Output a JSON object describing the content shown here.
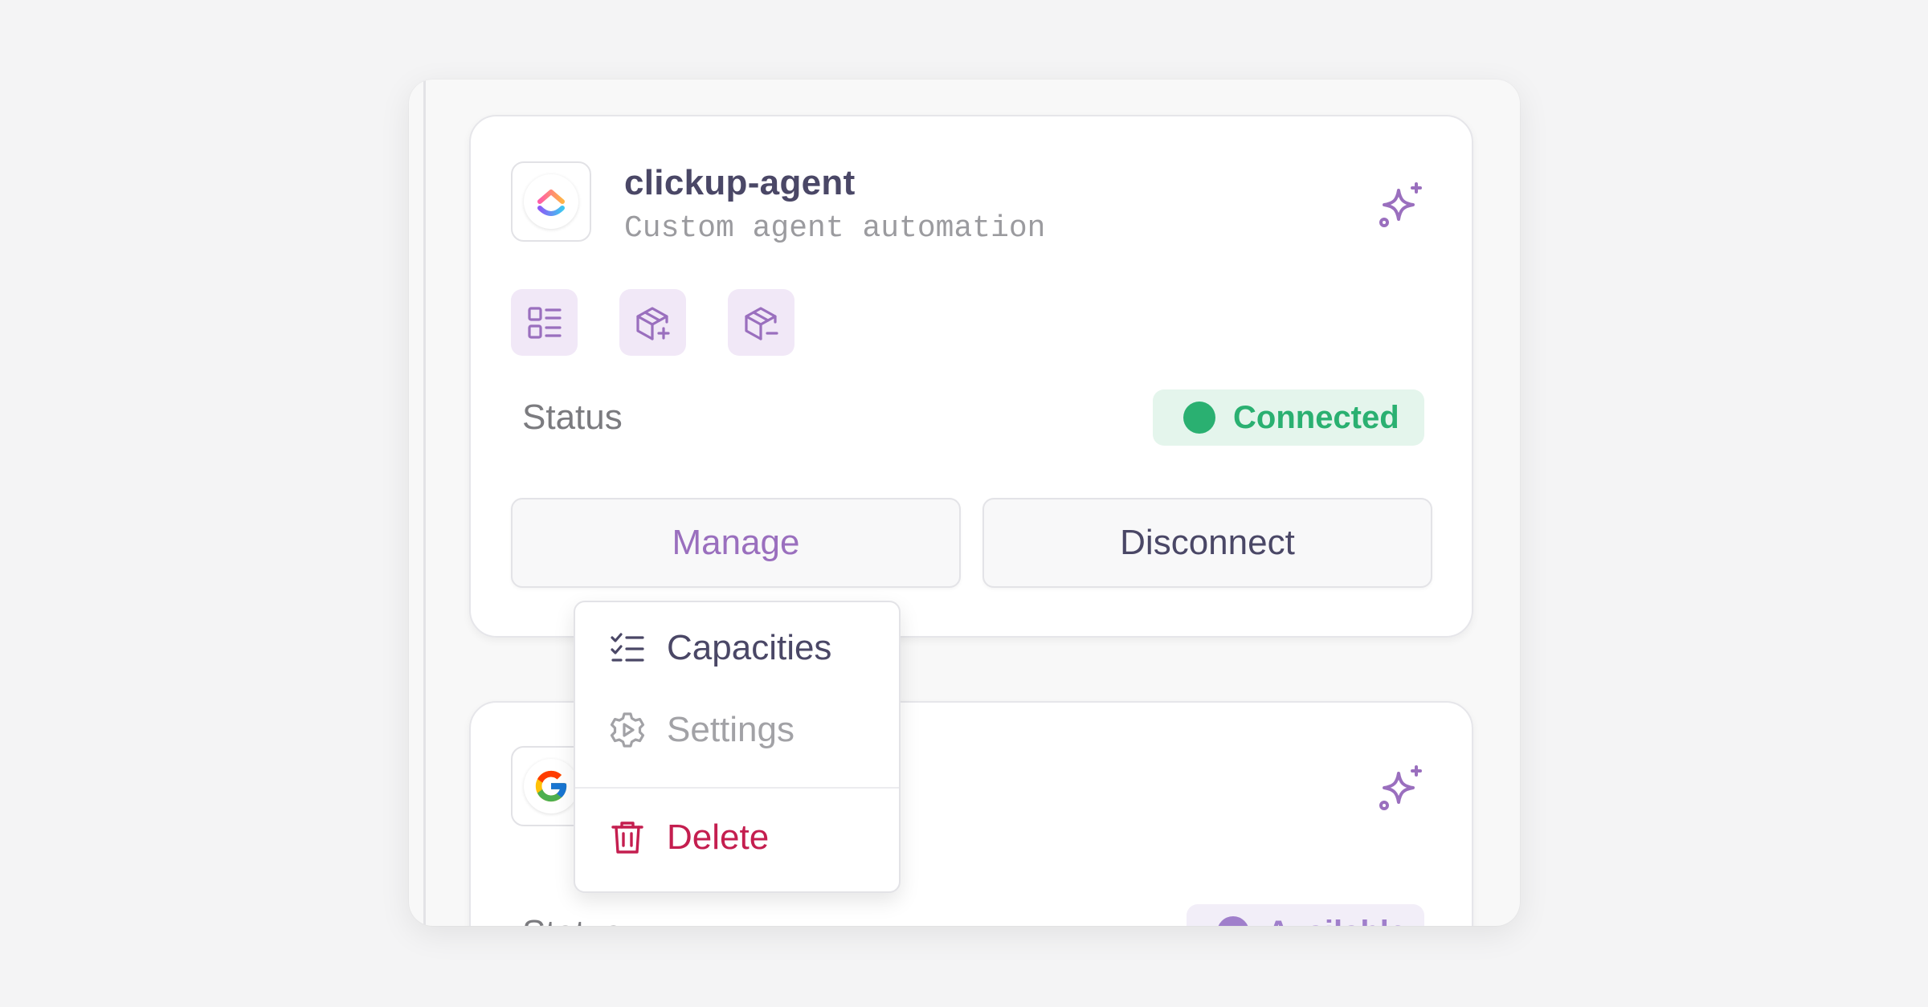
{
  "cards": [
    {
      "title": "clickup-agent",
      "subtitle": "Custom agent automation",
      "logo_icon": "clickup-logo-icon",
      "capability_icons": [
        "list-details-icon",
        "package-plus-icon",
        "package-minus-icon"
      ],
      "status_label": "Status",
      "status_value": "Connected",
      "status_color": "#2ab071",
      "actions": {
        "manage": "Manage",
        "disconnect": "Disconnect"
      }
    },
    {
      "logo_icon": "google-logo-icon",
      "status_label": "Status",
      "status_value": "Available",
      "status_color": "#a07fcb"
    }
  ],
  "dropdown": {
    "items": [
      {
        "label": "Capacities",
        "icon": "checklist-icon"
      },
      {
        "label": "Settings",
        "icon": "gear-icon"
      },
      {
        "label": "Delete",
        "icon": "trash-icon",
        "color": "#c41e4f"
      }
    ]
  },
  "colors": {
    "accent": "#9a6fbe",
    "text": "#4a4766",
    "danger": "#c41e4f"
  }
}
